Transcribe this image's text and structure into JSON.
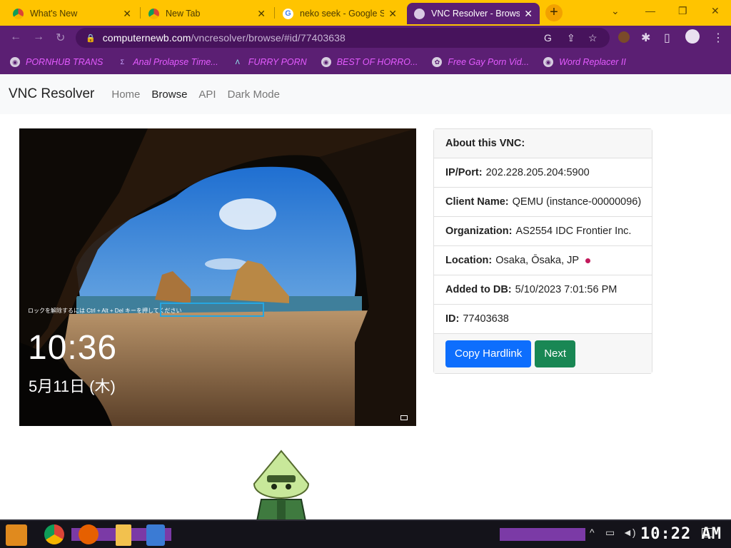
{
  "browser": {
    "tabs": [
      {
        "title": "What's New",
        "icon": "chrome-icon",
        "active": false
      },
      {
        "title": "New Tab",
        "icon": "chrome-icon",
        "active": false
      },
      {
        "title": "neko seek - Google Se",
        "icon": "google-icon",
        "active": false
      },
      {
        "title": "VNC Resolver - Brows",
        "icon": "vnc-resolver-icon",
        "active": true
      }
    ],
    "url_host": "computernewb.com",
    "url_path": "/vncresolver/browse/#id/77403638",
    "bookmarks": [
      "PORNHUB TRANS",
      "Anal Prolapse Time...",
      "FURRY PORN",
      "BEST OF HORRO...",
      "Free Gay Porn Vid...",
      "Word Replacer II"
    ],
    "colors": {
      "tabstrip": "#ffc400",
      "toolbar": "#5b1f73",
      "bookmark_text": "#e45bff"
    }
  },
  "site": {
    "brand": "VNC Resolver",
    "nav": [
      "Home",
      "Browse",
      "API",
      "Dark Mode"
    ],
    "active_nav": "Browse"
  },
  "screenshot": {
    "time": "10:36",
    "date": "5月11日 (木)",
    "hint": "ロックを解除するには Ctrl + Alt + Del キーを押してください"
  },
  "info": {
    "header": "About this VNC:",
    "ip_label": "IP/Port:",
    "ip_value": "202.228.205.204:5900",
    "client_label": "Client Name:",
    "client_value": "QEMU (instance-00000096)",
    "org_label": "Organization:",
    "org_value": "AS2554 IDC Frontier Inc.",
    "location_label": "Location:",
    "location_value": "Osaka, Ōsaka, JP",
    "added_label": "Added to DB:",
    "added_value": "5/10/2023 7:01:56 PM",
    "id_label": "ID:",
    "id_value": "77403638",
    "copy_button": "Copy Hardlink",
    "next_button": "Next"
  },
  "taskbar": {
    "clock": "10:22 AM"
  }
}
